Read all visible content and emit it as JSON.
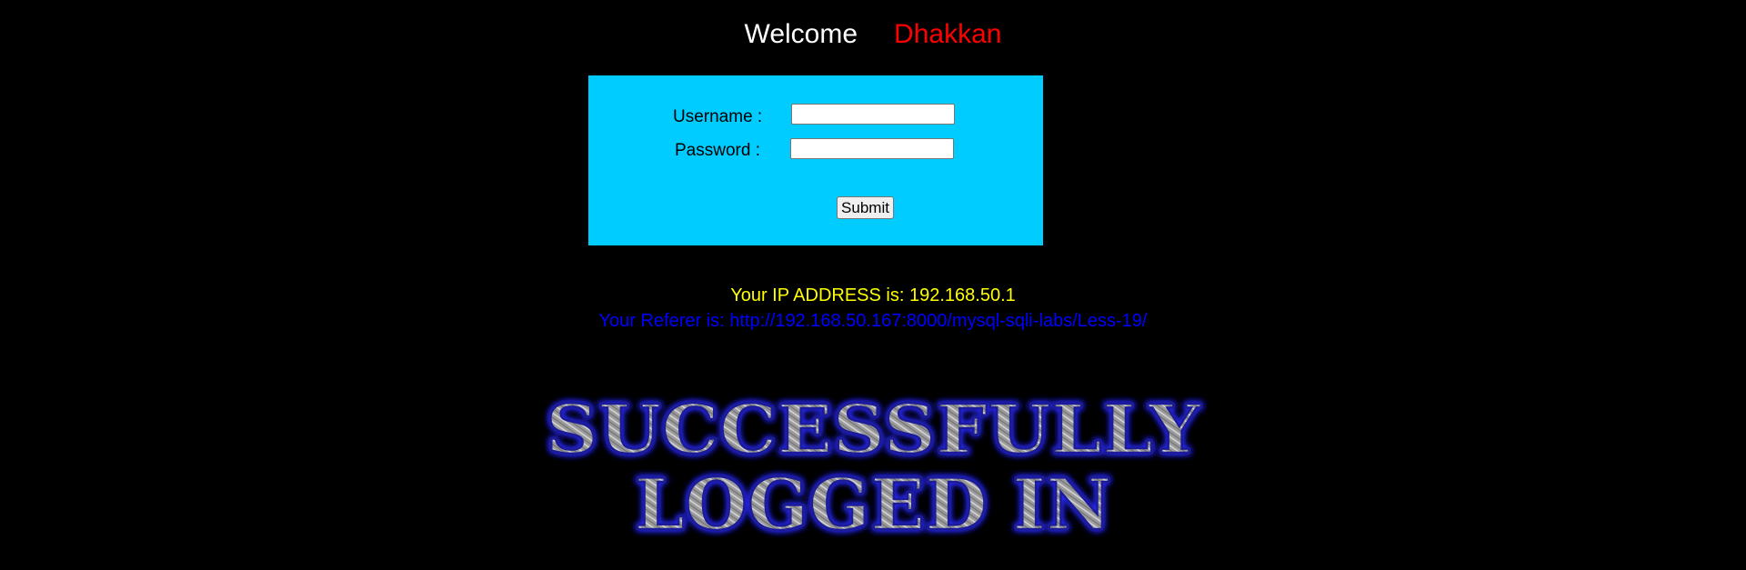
{
  "header": {
    "welcome": "Welcome",
    "user": "Dhakkan"
  },
  "login_form": {
    "username_label": "Username :",
    "password_label": "Password :",
    "username_value": "",
    "password_value": "",
    "submit_label": "Submit"
  },
  "info": {
    "ip_text": "Your IP ADDRESS is: 192.168.50.1",
    "referer_text": "Your Referer is: http://192.168.50.167:8000/mysql-sqli-labs/Less-19/"
  },
  "banner": {
    "line1": "SUCCESSFULLY",
    "line2": "LOGGED IN"
  },
  "colors": {
    "background": "#000000",
    "form_background": "#00ccff",
    "welcome": "#ffffff",
    "user_name": "#ff0000",
    "ip_text": "#ffff00",
    "referer_text": "#0000ff",
    "banner_glow": "#2222ff"
  }
}
